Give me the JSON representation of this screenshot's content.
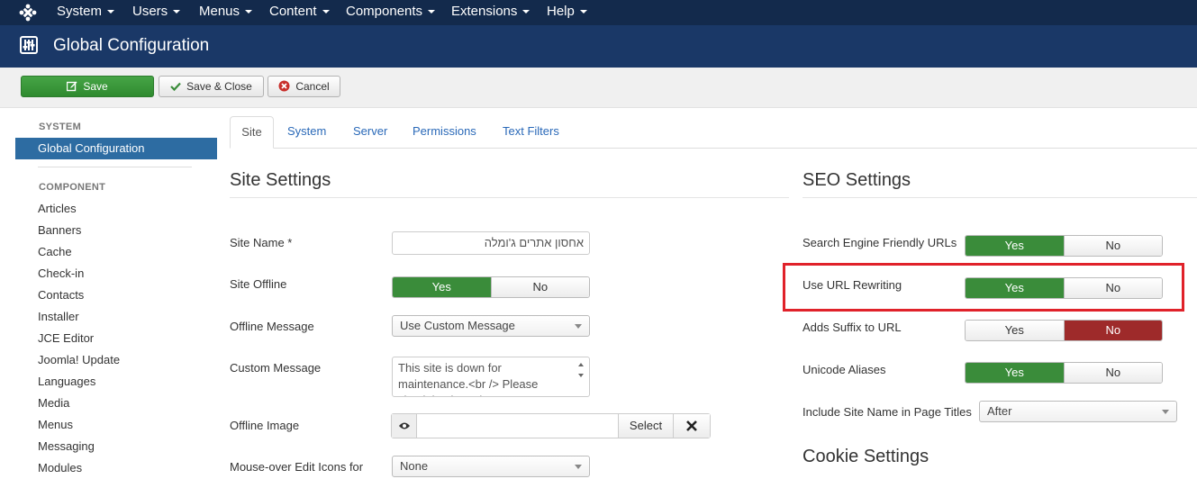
{
  "nav": {
    "items": [
      "System",
      "Users",
      "Menus",
      "Content",
      "Components",
      "Extensions",
      "Help"
    ]
  },
  "header": {
    "title": "Global Configuration"
  },
  "toolbar": {
    "save": "Save",
    "save_close": "Save & Close",
    "cancel": "Cancel"
  },
  "sidebar": {
    "system_heading": "SYSTEM",
    "active_item": "Global Configuration",
    "component_heading": "COMPONENT",
    "items": [
      "Articles",
      "Banners",
      "Cache",
      "Check-in",
      "Contacts",
      "Installer",
      "JCE Editor",
      "Joomla! Update",
      "Languages",
      "Media",
      "Menus",
      "Messaging",
      "Modules"
    ]
  },
  "tabs": [
    "Site",
    "System",
    "Server",
    "Permissions",
    "Text Filters"
  ],
  "site_settings": {
    "title": "Site Settings",
    "site_name_label": "Site Name *",
    "site_name_value": "אחסון אתרים ג'ומלה",
    "site_offline_label": "Site Offline",
    "yes": "Yes",
    "no": "No",
    "offline_message_label": "Offline Message",
    "offline_message_value": "Use Custom Message",
    "custom_message_label": "Custom Message",
    "custom_message_value": "This site is down for maintenance.<br /> Please check back again soon.",
    "offline_image_label": "Offline Image",
    "select_button": "Select",
    "mouseover_label": "Mouse-over Edit Icons for",
    "mouseover_value": "None"
  },
  "seo_settings": {
    "title": "SEO Settings",
    "sef_label": "Search Engine Friendly URLs",
    "rewrite_label": "Use URL Rewriting",
    "suffix_label": "Adds Suffix to URL",
    "unicode_label": "Unicode Aliases",
    "site_name_titles_label": "Include Site Name in Page Titles",
    "site_name_titles_value": "After"
  },
  "cookie_settings": {
    "title": "Cookie Settings"
  },
  "colors": {
    "nav_bg": "#132a4c",
    "header_bg": "#1a3867",
    "yes_active": "#3a8c3a",
    "no_active": "#9e2a2a",
    "highlight": "#e0222a"
  }
}
